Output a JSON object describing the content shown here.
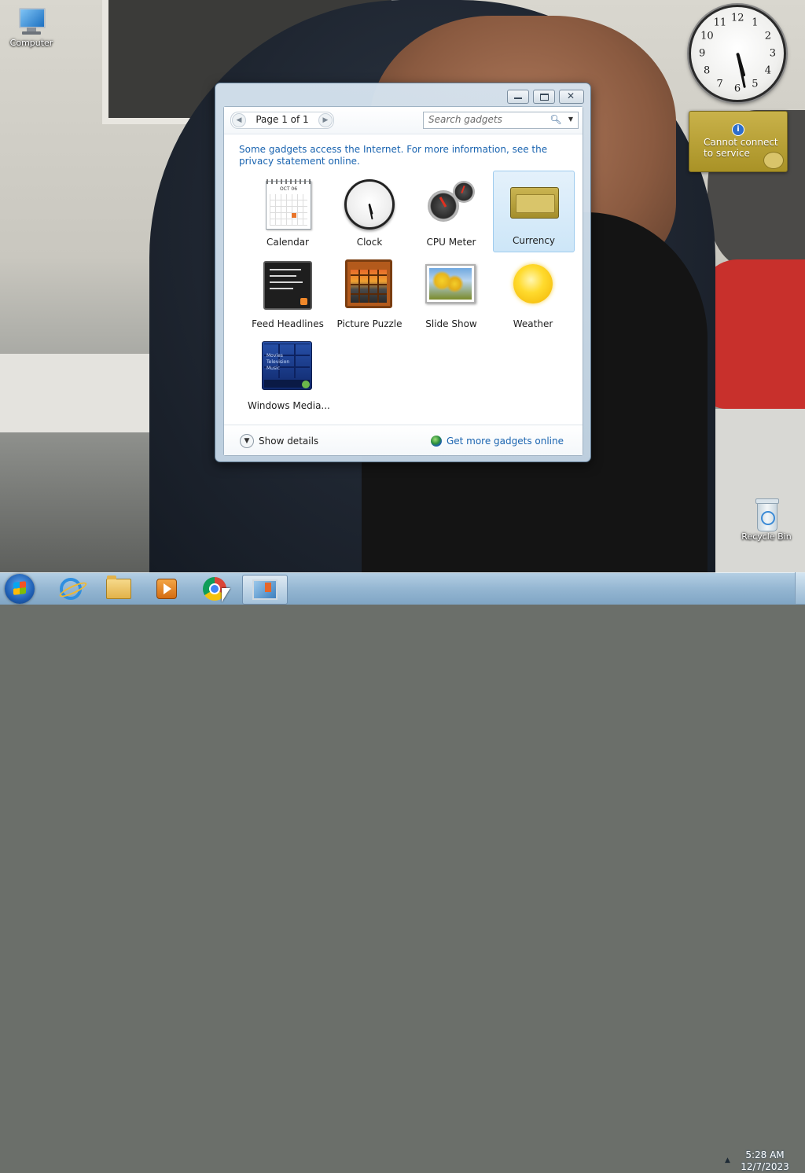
{
  "desktop": {
    "icons": [
      {
        "label": "Computer",
        "icon": "computer-icon"
      },
      {
        "label": "Recycle Bin",
        "icon": "recycle-bin-icon"
      }
    ],
    "gadgets": {
      "clock": {
        "numbers": [
          "12",
          "1",
          "2",
          "3",
          "4",
          "5",
          "6",
          "7",
          "8",
          "9",
          "10",
          "11"
        ],
        "time": "5:28"
      },
      "currency": {
        "message_line1": "Cannot connect",
        "message_line2": "to service",
        "icon": "info-icon"
      }
    }
  },
  "gallery": {
    "pager_text": "Page 1 of 1",
    "search_placeholder": "Search gadgets",
    "notice_text": "Some gadgets access the Internet.  For more information, see the privacy statement online.",
    "gadgets": [
      {
        "label": "Calendar",
        "icon": "calendar-gadget-icon",
        "calendar_month": "OCT 06"
      },
      {
        "label": "Clock",
        "icon": "clock-gadget-icon"
      },
      {
        "label": "CPU Meter",
        "icon": "cpu-meter-gadget-icon"
      },
      {
        "label": "Currency",
        "icon": "currency-gadget-icon",
        "selected": true
      },
      {
        "label": "Feed Headlines",
        "icon": "feed-headlines-gadget-icon"
      },
      {
        "label": "Picture Puzzle",
        "icon": "picture-puzzle-gadget-icon"
      },
      {
        "label": "Slide Show",
        "icon": "slide-show-gadget-icon"
      },
      {
        "label": "Weather",
        "icon": "weather-gadget-icon"
      },
      {
        "label": "Windows Media...",
        "icon": "windows-media-center-gadget-icon",
        "menu_items": [
          "Movies",
          "Television",
          "Music"
        ]
      }
    ],
    "show_details_label": "Show details",
    "get_more_label": "Get more gadgets online"
  },
  "taskbar": {
    "apps": [
      {
        "name": "Internet Explorer",
        "icon": "internet-explorer-icon"
      },
      {
        "name": "Windows Explorer",
        "icon": "folder-icon"
      },
      {
        "name": "Windows Media Player",
        "icon": "media-player-icon"
      },
      {
        "name": "Google Chrome",
        "icon": "chrome-icon"
      },
      {
        "name": "Desktop Gadget Gallery",
        "icon": "gadget-gallery-icon",
        "active": true
      }
    ],
    "clock_time": "5:28 AM",
    "clock_date": "12/7/2023"
  },
  "colors": {
    "link": "#1a64b0",
    "selection": "#cde6f8",
    "currency_gadget": "#b39c30"
  }
}
